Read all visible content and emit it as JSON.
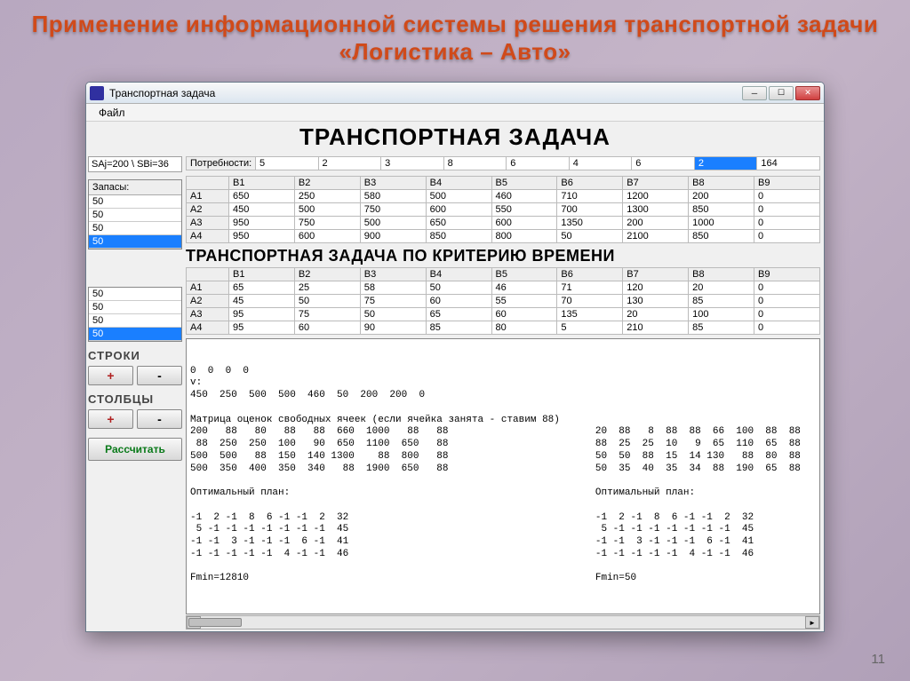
{
  "slide_title": "Применение информационной системы решения транспортной задачи «Логистика – Авто»",
  "page_number": "11",
  "window": {
    "title": "Транспортная задача",
    "menu_file": "Файл",
    "heading": "ТРАНСПОРТНАЯ ЗАДАЧА",
    "sum_label": "SAj=200 \\ SBi=36",
    "demands_label": "Потребности:",
    "demands": [
      "5",
      "2",
      "3",
      "8",
      "6",
      "4",
      "6",
      "2",
      "164"
    ],
    "demands_selected_index": 7,
    "stocks_label": "Запасы:",
    "stocks_top": [
      "50",
      "50",
      "50",
      "50"
    ],
    "stocks_top_selected_index": 3,
    "stocks_bottom": [
      "50",
      "50",
      "50",
      "50"
    ],
    "stocks_bottom_selected_index": 3,
    "rows_label": "СТРОКИ",
    "cols_label": "СТОЛБЦЫ",
    "plus": "+",
    "minus": "-",
    "calculate": "Рассчитать",
    "cost_col_headers": [
      "",
      "B1",
      "B2",
      "B3",
      "B4",
      "B5",
      "B6",
      "B7",
      "B8",
      "B9"
    ],
    "cost_rows": [
      [
        "A1",
        "650",
        "250",
        "580",
        "500",
        "460",
        "710",
        "1200",
        "200",
        "0"
      ],
      [
        "A2",
        "450",
        "500",
        "750",
        "600",
        "550",
        "700",
        "1300",
        "850",
        "0"
      ],
      [
        "A3",
        "950",
        "750",
        "500",
        "650",
        "600",
        "1350",
        "200",
        "1000",
        "0"
      ],
      [
        "A4",
        "950",
        "600",
        "900",
        "850",
        "800",
        "50",
        "2100",
        "850",
        "0"
      ]
    ],
    "sub_heading": "ТРАНСПОРТНАЯ ЗАДАЧА ПО КРИТЕРИЮ ВРЕМЕНИ",
    "time_col_headers": [
      "",
      "B1",
      "B2",
      "B3",
      "B4",
      "B5",
      "B6",
      "B7",
      "B8",
      "B9"
    ],
    "time_rows": [
      [
        "A1",
        "65",
        "25",
        "58",
        "50",
        "46",
        "71",
        "120",
        "20",
        "0"
      ],
      [
        "A2",
        "45",
        "50",
        "75",
        "60",
        "55",
        "70",
        "130",
        "85",
        "0"
      ],
      [
        "A3",
        "95",
        "75",
        "50",
        "65",
        "60",
        "135",
        "20",
        "100",
        "0"
      ],
      [
        "A4",
        "95",
        "60",
        "90",
        "85",
        "80",
        "5",
        "210",
        "85",
        "0"
      ]
    ],
    "results_left": "0  0  0  0\nv:\n450  250  500  500  460  50  200  200  0\n\nМатрица оценок свободных ячеек (если ячейка занята - ставим 88)\n200   88   80   88   88  660  1000   88   88\n 88  250  250  100   90  650  1100  650   88\n500  500   88  150  140 1300    88  800   88\n500  350  400  350  340   88  1900  650   88\n\nОптимальный план:\n\n-1  2 -1  8  6 -1 -1  2  32\n 5 -1 -1 -1 -1 -1 -1 -1  45\n-1 -1  3 -1 -1 -1  6 -1  41\n-1 -1 -1 -1 -1  4 -1 -1  46\n\nFmin=12810",
    "results_right": "\n\n\n\n\n20  88   8  88  88  66  100  88  88\n88  25  25  10   9  65  110  65  88\n50  50  88  15  14 130   88  80  88\n50  35  40  35  34  88  190  65  88\n\nОптимальный план:\n\n-1  2 -1  8  6 -1 -1  2  32\n 5 -1 -1 -1 -1 -1 -1 -1  45\n-1 -1  3 -1 -1 -1  6 -1  41\n-1 -1 -1 -1 -1  4 -1 -1  46\n\nFmin=50"
  }
}
